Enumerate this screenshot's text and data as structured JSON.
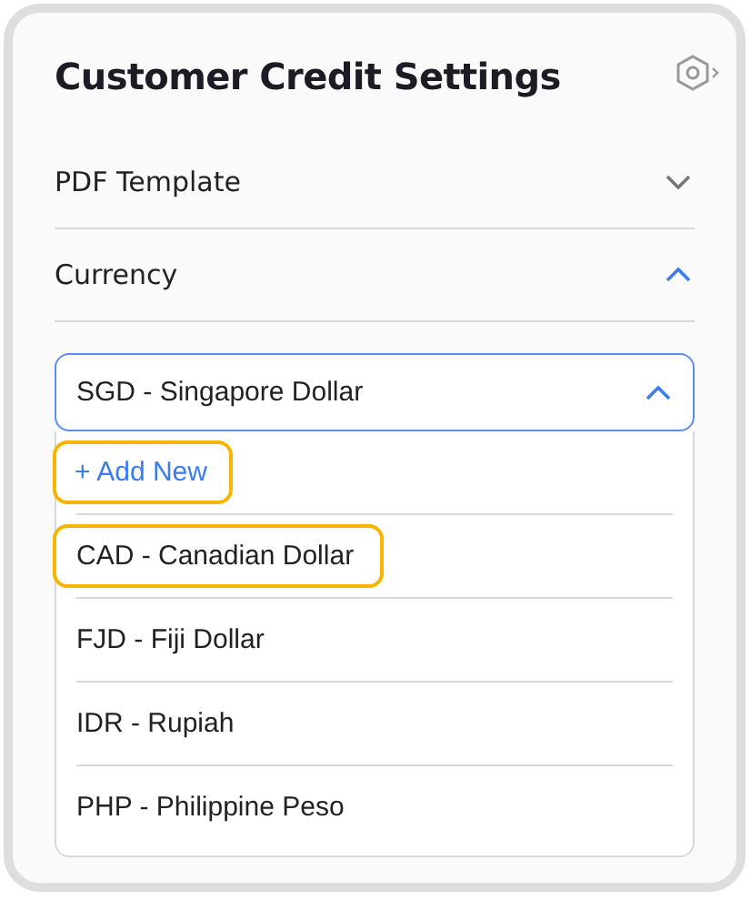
{
  "panel": {
    "title": "Customer Credit Settings"
  },
  "sections": [
    {
      "label": "PDF Template",
      "expanded": false
    },
    {
      "label": "Currency",
      "expanded": true
    }
  ],
  "currency_select": {
    "value": "SGD - Singapore Dollar",
    "open": true
  },
  "add_new": {
    "label": "+ Add New",
    "highlighted": true
  },
  "options": [
    {
      "label": "CAD - Canadian Dollar",
      "highlighted": true
    },
    {
      "label": "FJD - Fiji Dollar",
      "highlighted": false
    },
    {
      "label": "IDR - Rupiah",
      "highlighted": false
    },
    {
      "label": "PHP - Philippine Peso",
      "highlighted": false
    }
  ]
}
